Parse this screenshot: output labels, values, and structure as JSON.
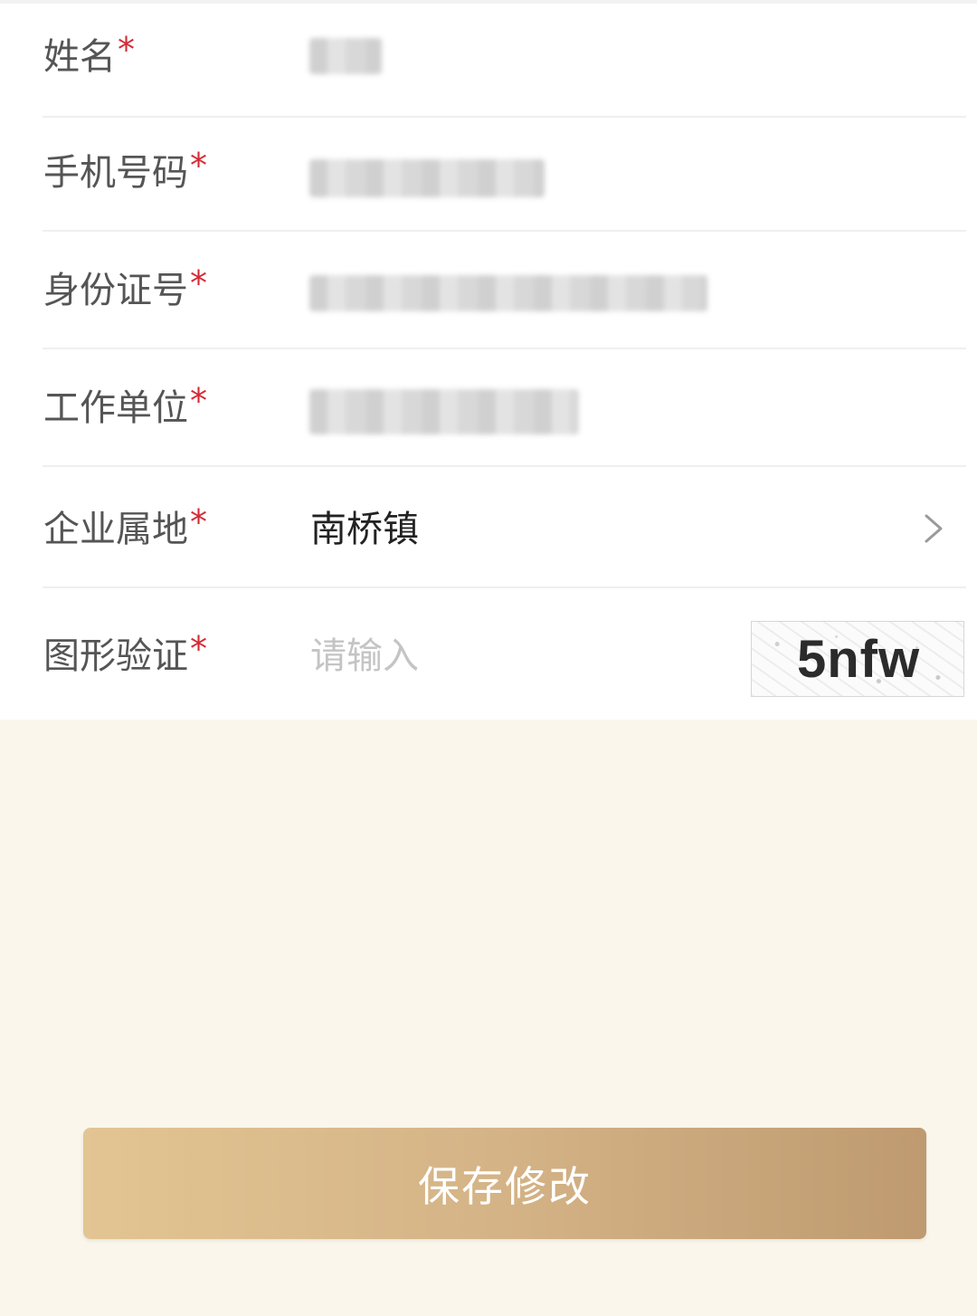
{
  "form": {
    "name_label": "姓名",
    "phone_label": "手机号码",
    "id_label": "身份证号",
    "workplace_label": "工作单位",
    "location_label": "企业属地",
    "location_value": "南桥镇",
    "captcha_label": "图形验证",
    "captcha_placeholder": "请输入",
    "captcha_code": "5nfw",
    "required_mark": "*"
  },
  "actions": {
    "save_label": "保存修改"
  },
  "colors": {
    "required": "#d42a36",
    "button_start": "#e2c592",
    "button_end": "#bf9a70",
    "page_bg": "#faf6ec"
  },
  "icons": {
    "location_arrow": "chevron-right-icon"
  }
}
